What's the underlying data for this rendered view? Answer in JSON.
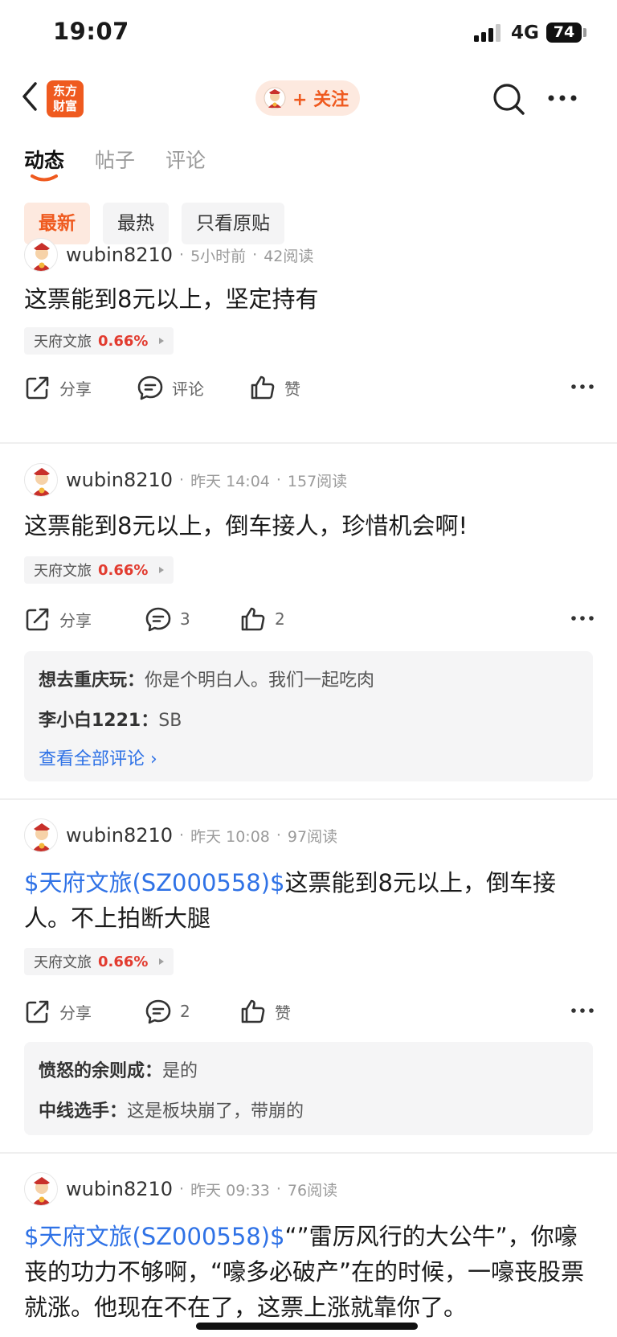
{
  "status_bar": {
    "time": "19:07",
    "network": "4G",
    "battery": "74"
  },
  "nav": {
    "logo_text_line1": "东方",
    "logo_text_line2": "财富",
    "follow_label": "+ 关注"
  },
  "tabs": [
    {
      "label": "动态",
      "active": true
    },
    {
      "label": "帖子",
      "active": false
    },
    {
      "label": "评论",
      "active": false
    }
  ],
  "filters": [
    {
      "label": "最新",
      "active": true
    },
    {
      "label": "最热",
      "active": false
    },
    {
      "label": "只看原贴",
      "active": false
    }
  ],
  "colors": {
    "accent": "#ef5a1f",
    "link": "#2f72e6",
    "up": "#e23b2f"
  },
  "posts": [
    {
      "user": "wubin8210",
      "time": "5小时前",
      "reads": "42阅读",
      "text": "这票能到8元以上，坚定持有",
      "stock_name": "天府文旅",
      "stock_pct": "0.66%",
      "share": "分享",
      "comment": "评论",
      "like": "赞"
    },
    {
      "user": "wubin8210",
      "time": "昨天 14:04",
      "reads": "157阅读",
      "text": "这票能到8元以上，倒车接人，珍惜机会啊!",
      "stock_name": "天府文旅",
      "stock_pct": "0.66%",
      "share": "分享",
      "comment": "3",
      "like": "2",
      "comments": [
        {
          "author": "想去重庆玩：",
          "text": "你是个明白人。我们一起吃肉"
        },
        {
          "author": "李小白1221：",
          "text": "SB"
        }
      ],
      "view_all": "查看全部评论 ›"
    },
    {
      "user": "wubin8210",
      "time": "昨天 10:08",
      "reads": "97阅读",
      "link": "$天府文旅(SZ000558)$",
      "text": "这票能到8元以上，倒车接人。不上拍断大腿",
      "stock_name": "天府文旅",
      "stock_pct": "0.66%",
      "share": "分享",
      "comment": "2",
      "like": "赞",
      "comments": [
        {
          "author": "愤怒的余则成：",
          "text": "是的"
        },
        {
          "author": "中线选手：",
          "text": "这是板块崩了，带崩的"
        }
      ]
    },
    {
      "user": "wubin8210",
      "time": "昨天 09:33",
      "reads": "76阅读",
      "link": "$天府文旅(SZ000558)$",
      "text": "“”雷厉风行的大公牛”，你嚎丧的功力不够啊，“嚎多必破产”在的时候，一嚎丧股票就涨。他现在不在了，这票上涨就靠你了。"
    }
  ]
}
